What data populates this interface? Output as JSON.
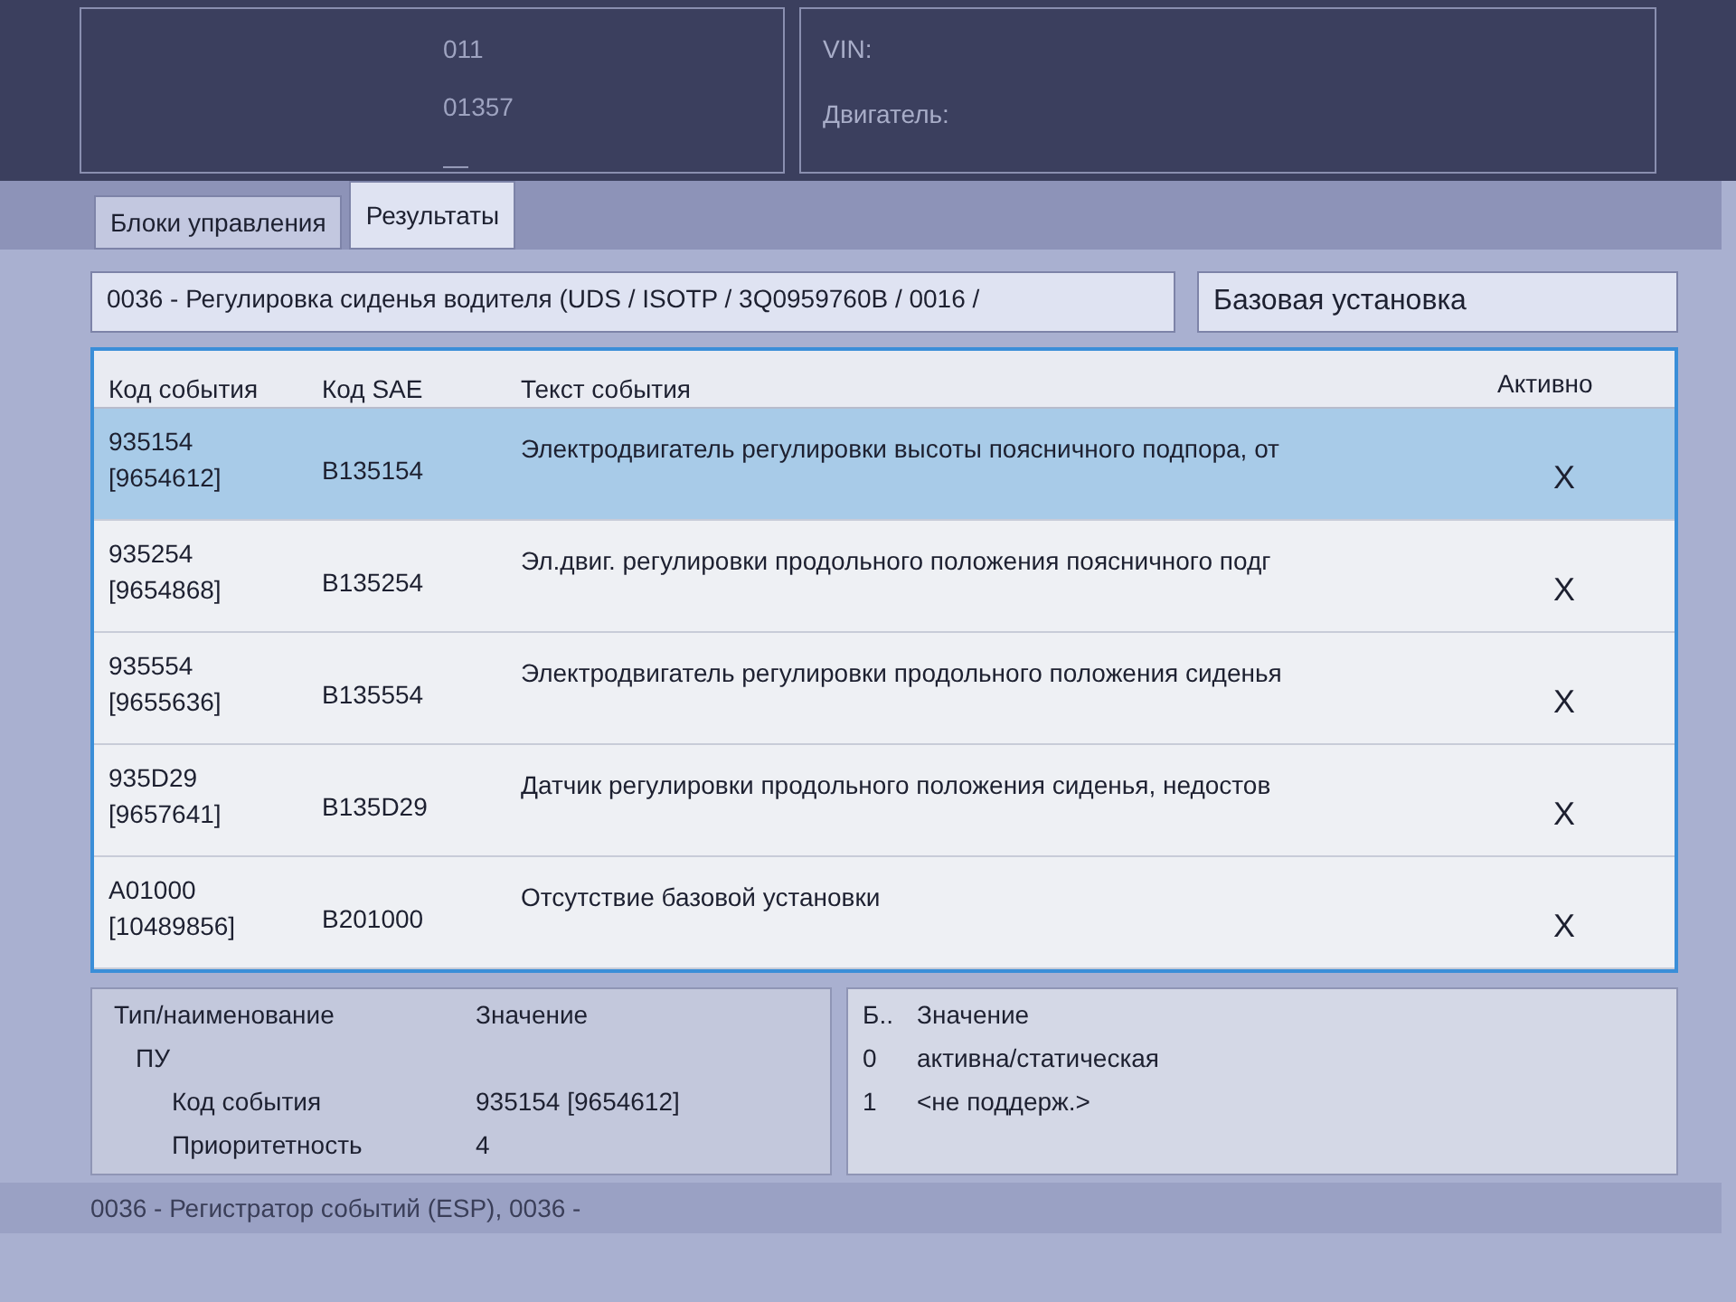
{
  "header": {
    "left_values": [
      "011",
      "01357",
      "—"
    ],
    "right_labels": [
      "VIN:",
      "Двигатель:"
    ]
  },
  "tabs": [
    {
      "label": "Блоки управления",
      "selected": false
    },
    {
      "label": "Результаты",
      "selected": true
    }
  ],
  "unit_title": "0036 - Регулировка сиденья водителя  (UDS / ISOTP / 3Q0959760B / 0016 /",
  "mode_select": {
    "value": "Базовая установка"
  },
  "table": {
    "columns": [
      "Код события",
      "Код SAE",
      "Текст события",
      "Активно"
    ],
    "rows": [
      {
        "code": "935154",
        "code_2": "[9654612]",
        "sae": "B135154",
        "text": "Электродвигатель регулировки высоты поясничного подпора, от",
        "active": "X",
        "selected": true
      },
      {
        "code": "935254",
        "code_2": "[9654868]",
        "sae": "B135254",
        "text": "Эл.двиг. регулировки продольного положения поясничного подг",
        "active": "X",
        "selected": false
      },
      {
        "code": "935554",
        "code_2": "[9655636]",
        "sae": "B135554",
        "text": "Электродвигатель регулировки продольного положения сиденья",
        "active": "X",
        "selected": false
      },
      {
        "code": "935D29",
        "code_2": "[9657641]",
        "sae": "B135D29",
        "text": "Датчик регулировки продольного положения сиденья, недостов",
        "active": "X",
        "selected": false
      },
      {
        "code": "A01000",
        "code_2": "[10489856]",
        "sae": "B201000",
        "text": "Отсутствие базовой установки",
        "active": "X",
        "selected": false
      }
    ]
  },
  "details": {
    "columns": [
      "Тип/наименование",
      "Значение"
    ],
    "tree": [
      {
        "name": "ПУ",
        "children": [
          {
            "name": "Код события",
            "value": "935154 [9654612]"
          },
          {
            "name": "Приоритетность",
            "value": "4"
          }
        ]
      }
    ]
  },
  "bits": {
    "columns": [
      "Б..",
      "Значение"
    ],
    "rows": [
      {
        "bit": "0",
        "value": "активна/статическая"
      },
      {
        "bit": "1",
        "value": "<не поддерж.>"
      }
    ]
  },
  "status_bar": "0036 - Регистратор событий (ESP), 0036 -"
}
